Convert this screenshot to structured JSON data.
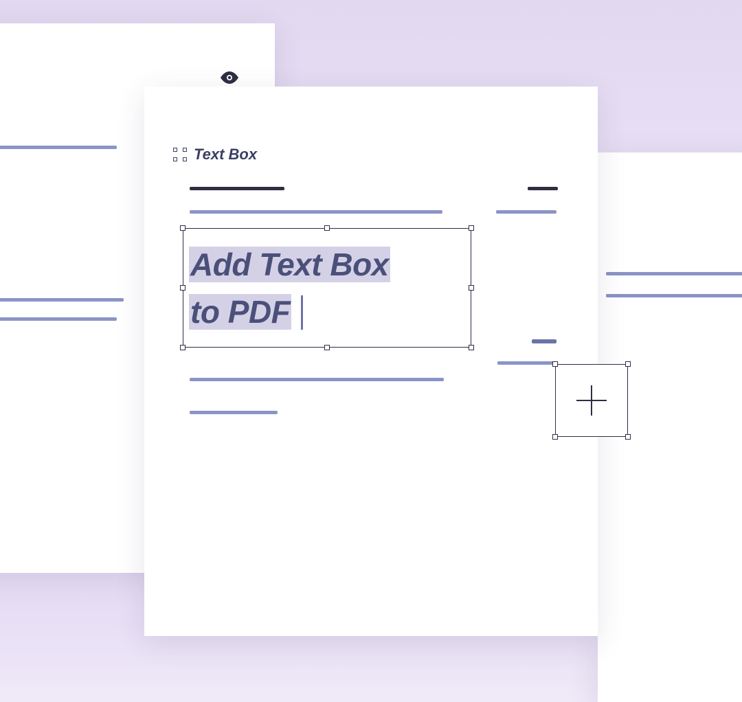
{
  "toolbar": {
    "textbox_label": "Text Box"
  },
  "textbox": {
    "content_line1": "Add Text Box",
    "content_line2": "to PDF"
  },
  "colors": {
    "text_primary": "#3a3f63",
    "text_heavy": "#4a5079",
    "line_light": "#8a94c6",
    "line_dark": "#2d2d44",
    "highlight": "#d4d1e7",
    "bg_lavender_top": "#e2d8f0"
  }
}
